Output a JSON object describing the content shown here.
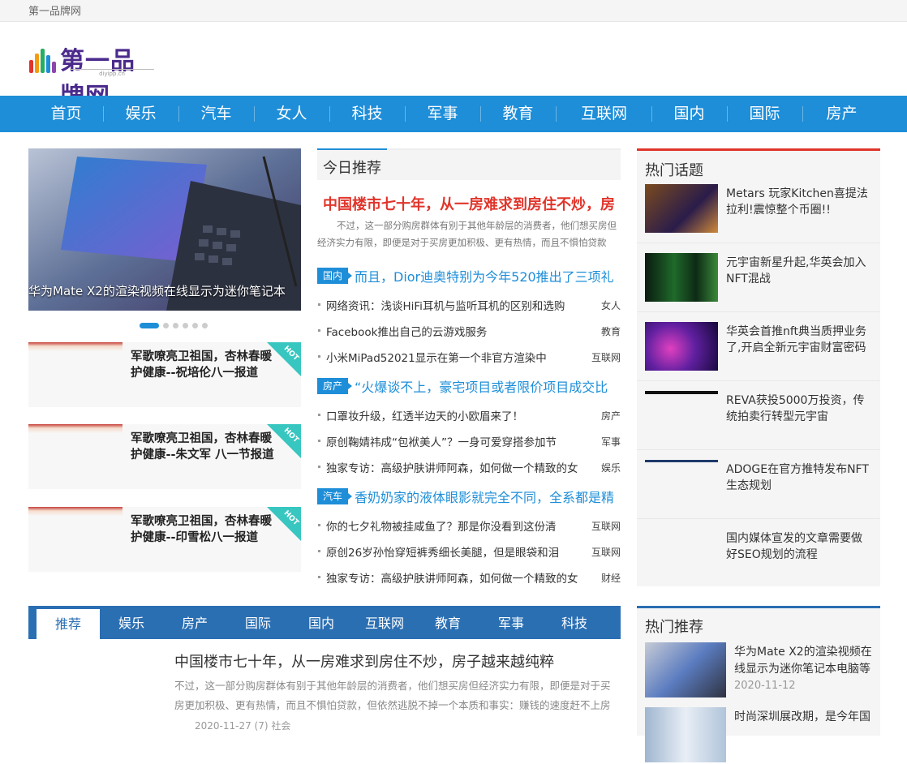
{
  "topbar": {
    "site_name": "第一品牌网"
  },
  "logo": {
    "text": "第一品牌网",
    "domain": "diyipp.cn"
  },
  "nav": [
    "首页",
    "娱乐",
    "汽车",
    "女人",
    "科技",
    "军事",
    "教育",
    "互联网",
    "国内",
    "国际",
    "房产"
  ],
  "slider": {
    "caption": "华为Mate X2的渲染视频在线显示为迷你笔记本"
  },
  "hot_cards": [
    {
      "title": "军歌嘹亮卫祖国，杏林春暖护健康--祝培伦八一报道",
      "badge": "HOT"
    },
    {
      "title": "军歌嘹亮卫祖国，杏林春暖护健康--朱文军 八一节报道",
      "badge": "HOT"
    },
    {
      "title": "军歌嘹亮卫祖国，杏林春暖护健康--印雪松八一报道",
      "badge": "HOT"
    }
  ],
  "today": {
    "heading": "今日推荐",
    "headline": "中国楼市七十年，从一房难求到房住不炒，房",
    "summary": "不过，这一部分购房群体有别于其他年龄层的消费者，他们想买房但经济实力有限，即便是对于买房更加积极、更有热情，而且不惧怕贷款"
  },
  "groups": [
    {
      "tag": "国内",
      "title": "而且，Dior迪奥特别为今年520推出了三项礼",
      "items": [
        {
          "text": "网络资讯：浅谈HiFi耳机与监听耳机的区别和选购",
          "cat": "女人"
        },
        {
          "text": "Facebook推出自己的云游戏服务",
          "cat": "教育"
        },
        {
          "text": "小米MiPad52021显示在第一个非官方渲染中",
          "cat": "互联网"
        }
      ]
    },
    {
      "tag": "房产",
      "title": "“火爆谈不上，豪宅项目或者限价项目成交比",
      "items": [
        {
          "text": "口罩妆升级，红透半边天的小欧眉来了！",
          "cat": "房产"
        },
        {
          "text": "原创鞠婧祎成“包袱美人”？一身可爱穿搭参加节",
          "cat": "军事"
        },
        {
          "text": "独家专访：高级护肤讲师阿森，如何做一个精致的女",
          "cat": "娱乐"
        }
      ]
    },
    {
      "tag": "汽车",
      "title": "香奶奶家的液体眼影就完全不同，全系都是精",
      "items": [
        {
          "text": "你的七夕礼物被挂咸鱼了？那是你没看到这份清",
          "cat": "互联网"
        },
        {
          "text": "原创26岁孙怡穿短裤秀细长美腿，但是眼袋和泪",
          "cat": "互联网"
        },
        {
          "text": "独家专访：高级护肤讲师阿森，如何做一个精致的女",
          "cat": "财经"
        }
      ]
    }
  ],
  "hot_topics": {
    "heading": "热门话题",
    "items": [
      "Metars 玩家Kitchen喜提法拉利!震惊整个币圈!!",
      "元宇宙新星升起,华英会加入NFT混战",
      "华英会首推nft典当质押业务了,开启全新元宇宙财富密码",
      "REVA获投5000万投资，传统拍卖行转型元宇宙",
      "ADOGE在官方推特发布NFT生态规划",
      "国内媒体宣发的文章需要做好SEO规划的流程"
    ]
  },
  "tabs": [
    "推荐",
    "娱乐",
    "房产",
    "国际",
    "国内",
    "互联网",
    "教育",
    "军事",
    "科技"
  ],
  "article": {
    "title": "中国楼市七十年，从一房难求到房住不炒，房子越来越纯粹",
    "summary": "不过，这一部分购房群体有别于其他年龄层的消费者，他们想买房但经济实力有限，即便是对于买房更加积极、更有热情，而且不惧怕贷款，但依然逃脱不掉一个本质和事实：赚钱的速度赶不上房价上涨的",
    "meta": "2020-11-27 (7) 社会"
  },
  "hot_recommend": {
    "heading": "热门推荐",
    "items": [
      {
        "title": "华为Mate X2的渲染视频在线显示为迷你笔记本电脑等",
        "date": "2020-11-12"
      },
      {
        "title": "时尚深圳展改期，是今年国",
        "date": ""
      }
    ]
  },
  "colors": {
    "nav_blue": "#1e8ed8",
    "accent_red": "#e0352b",
    "tab_blue": "#2b6fb3",
    "hot_teal": "#38c6c0"
  }
}
